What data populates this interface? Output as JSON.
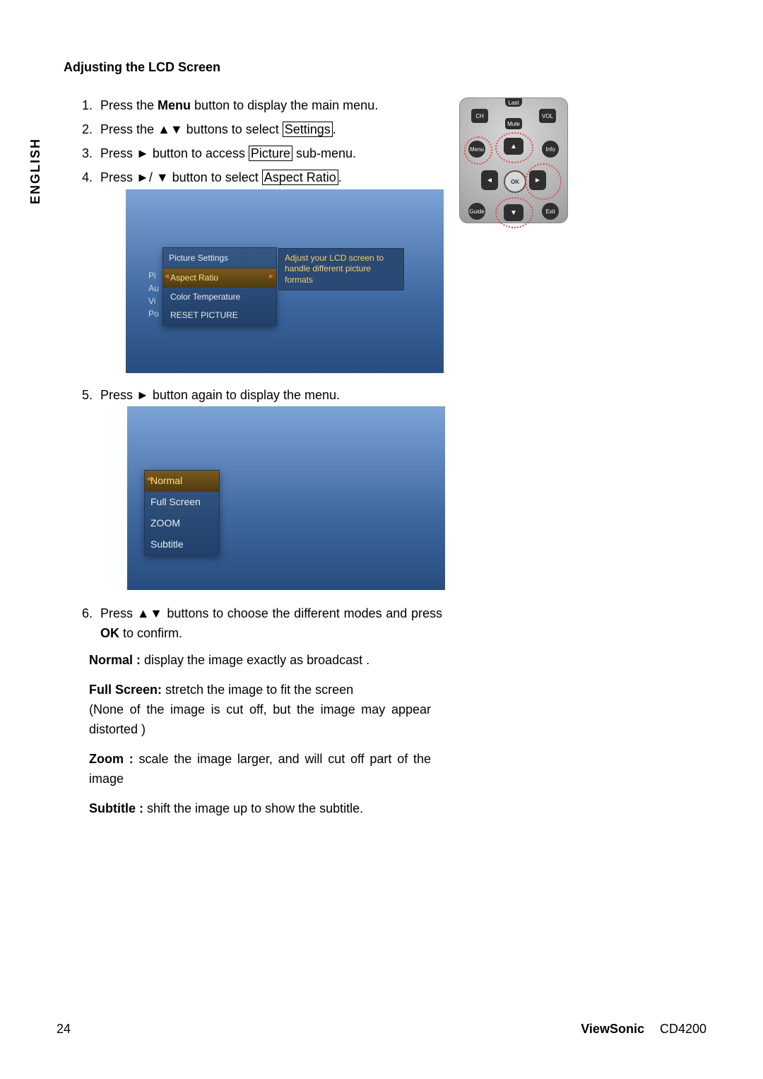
{
  "sideLabel": "ENGLISH",
  "heading": "Adjusting the LCD Screen",
  "steps": {
    "s1_a": "Press the ",
    "s1_bold": "Menu",
    "s1_b": " button to display the main menu.",
    "s2_a": "Press the ▲▼ buttons to select ",
    "s2_box": "Settings",
    "s2_b": ".",
    "s3_a": "Press ► button to access ",
    "s3_box": "Picture",
    "s3_b": " sub-menu.",
    "s4_a": "Press ►/ ▼ button to select ",
    "s4_box": "Aspect Ratio",
    "s4_b": ".",
    "s5": "Press ► button again to display the menu.",
    "s6_a": "Press ▲▼ buttons to choose the different modes and press ",
    "s6_bold": "OK",
    "s6_b": " to confirm."
  },
  "osd1": {
    "title": "Picture Settings",
    "items": [
      "Aspect Ratio",
      "Color Temperature",
      "RESET PICTURE"
    ],
    "leftLabels": [
      "Pi",
      "Au",
      "Vi",
      "Po"
    ],
    "desc": "Adjust your LCD screen to handle different picture formats"
  },
  "osd2": {
    "items": [
      "Normal",
      "Full Screen",
      "ZOOM",
      "Subtitle"
    ]
  },
  "modes": {
    "normal_label": "Normal :",
    "normal_text": " display the image exactly as broadcast .",
    "full_label": "Full Screen:",
    "full_text1": " stretch the image to fit the screen",
    "full_text2": "(None of the image is cut off, but the image may appear distorted )",
    "zoom_label": "Zoom :",
    "zoom_text": " scale the image larger, and will cut off part of the image",
    "sub_label": "Subtitle :",
    "sub_text": " shift the image up to show the subtitle."
  },
  "remote": {
    "last": "Last",
    "ch": "CH",
    "mute": "Mute",
    "vol": "VOL",
    "menu": "Menu",
    "info": "Info",
    "ok": "OK",
    "guide": "Guide",
    "exit": "Exit",
    "up": "▲",
    "down": "▼",
    "left": "◄",
    "right": "►"
  },
  "footer": {
    "page": "24",
    "brand": "ViewSonic",
    "model": "CD4200"
  }
}
